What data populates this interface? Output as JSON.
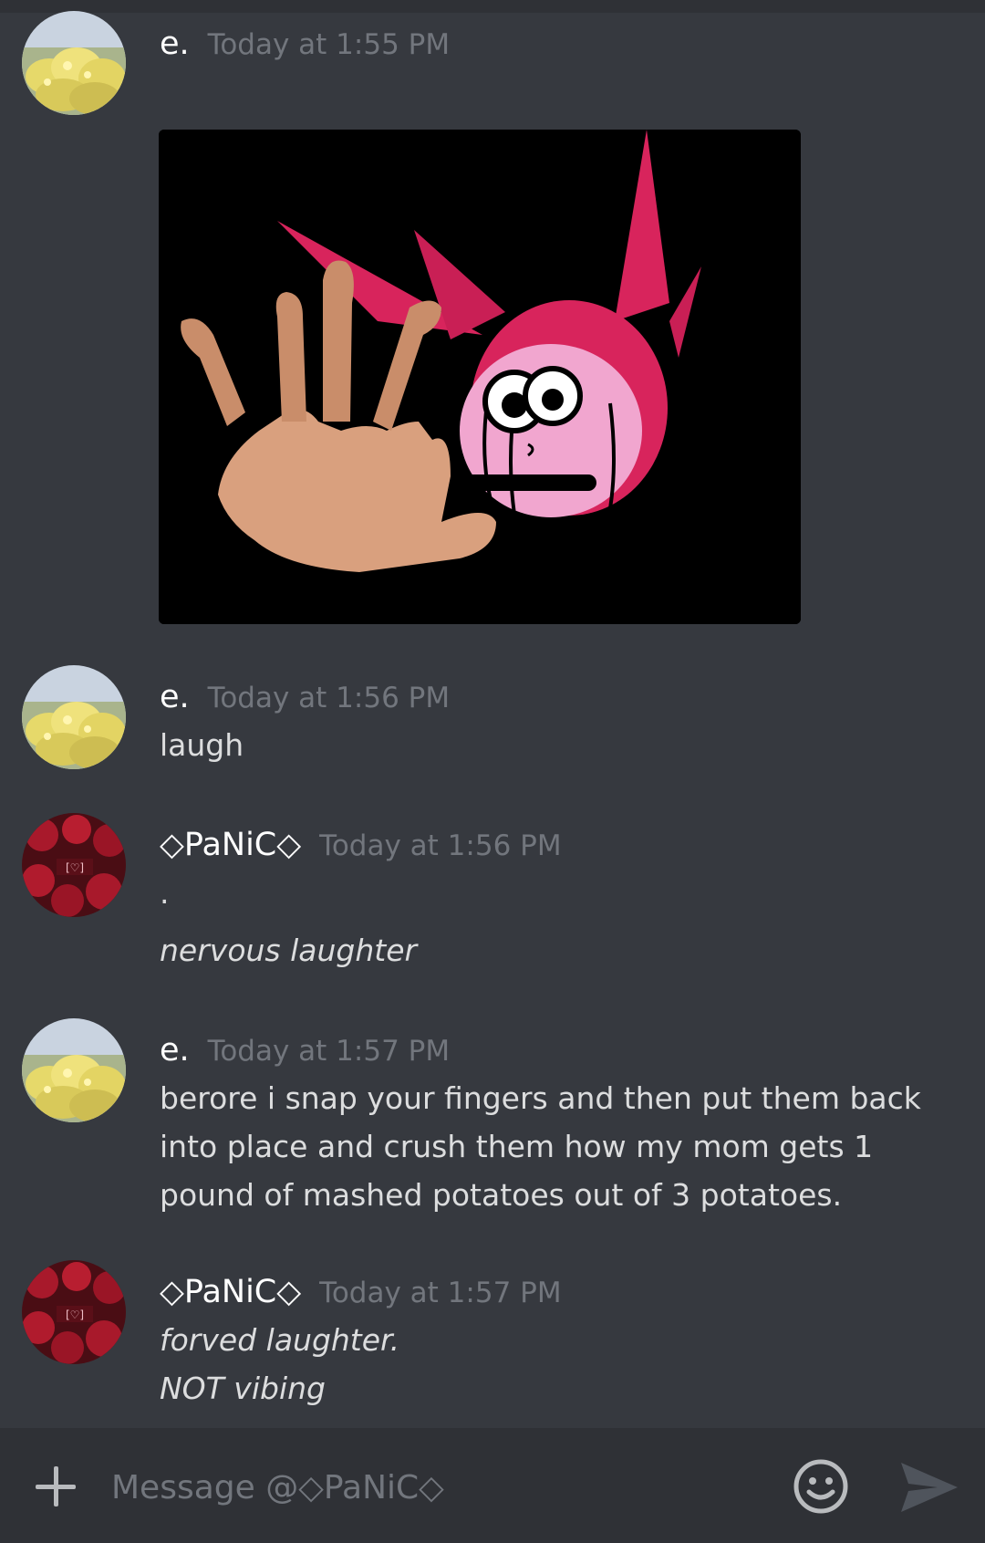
{
  "messages": [
    {
      "username": "e.",
      "timestamp": "Today at 1:55 PM",
      "attachment": "image"
    },
    {
      "username": "e.",
      "timestamp": "Today at 1:56 PM",
      "lines": [
        "laugh"
      ]
    },
    {
      "username": "◇PaNiC◇",
      "timestamp": "Today at 1:56 PM",
      "lines": [
        ".",
        "nervous laughter"
      ]
    },
    {
      "username": "e.",
      "timestamp": "Today at 1:57 PM",
      "lines": [
        "berore i snap your fingers and then put them back",
        "into place and crush them how my mom gets 1",
        "pound of mashed potatoes out of 3 potatoes."
      ]
    },
    {
      "username": "◇PaNiC◇",
      "timestamp": "Today at 1:57 PM",
      "lines": [
        "forved laughter.",
        "NOT vibing"
      ]
    }
  ],
  "composer": {
    "placeholder": "Message @◇PaNiC◇"
  },
  "icons": {
    "add": "plus-icon",
    "emoji": "smiley-icon",
    "send": "send-arrow-icon"
  },
  "colors": {
    "background": "#36393f",
    "composer_bg": "#2f3136",
    "username": "#ffffff",
    "timestamp": "#72767d",
    "text": "#dcddde"
  }
}
